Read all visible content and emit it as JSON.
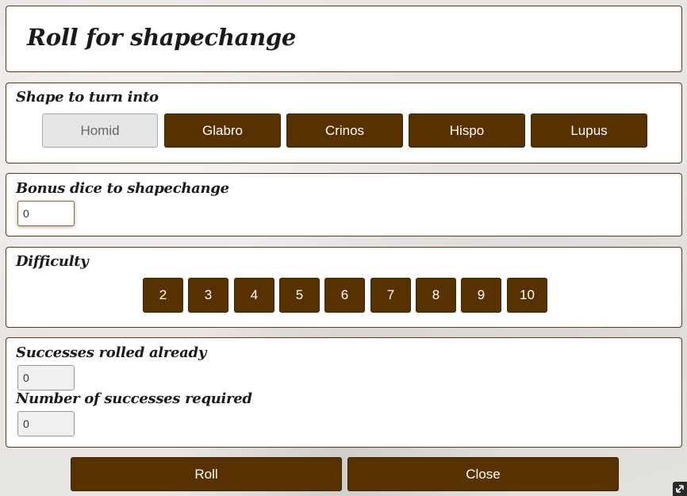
{
  "dialog": {
    "title": "Roll for shapechange"
  },
  "shape": {
    "label": "Shape to turn into",
    "options": [
      "Homid",
      "Glabro",
      "Crinos",
      "Hispo",
      "Lupus"
    ],
    "selected": "Homid"
  },
  "bonus": {
    "label": "Bonus dice to shapechange",
    "value": "0"
  },
  "difficulty": {
    "label": "Difficulty",
    "options": [
      "2",
      "3",
      "4",
      "5",
      "6",
      "7",
      "8",
      "9",
      "10"
    ]
  },
  "successes": {
    "rolled_label": "Successes rolled already",
    "rolled_value": "0",
    "required_label": "Number of successes required",
    "required_value": "0"
  },
  "actions": {
    "roll": "Roll",
    "close": "Close"
  },
  "colors": {
    "button": "#573200",
    "border": "#5a3a10",
    "selected": "#e6e6e6"
  },
  "icons": {
    "resize": "resize-grip-icon"
  }
}
